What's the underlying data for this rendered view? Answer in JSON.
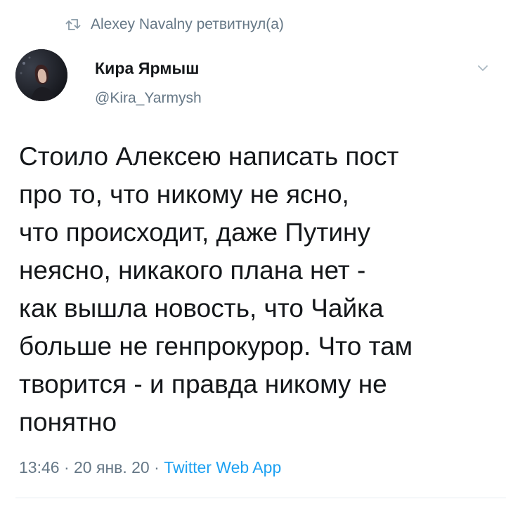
{
  "retweet_header": {
    "icon": "retweet-icon",
    "text": "Alexey Navalny ретвитнул(а)"
  },
  "author": {
    "avatar": "avatar-photo",
    "name": "Кира Ярмыш",
    "handle": "@Kira_Yarmysh"
  },
  "menu_icon": "chevron-down-icon",
  "tweet": {
    "lines": [
      "Стоило Алексею написать пост",
      "про то, что никому не ясно,",
      "что происходит, даже Путину",
      "неясно, никакого плана нет -",
      "как вышла новость, что Чайка",
      "больше не генпрокурор. Что там",
      "творится - и правда никому не",
      "понятно"
    ]
  },
  "meta": {
    "time": "13:46",
    "sep1": " · ",
    "date": "20 янв. 20",
    "sep2": " · ",
    "source": "Twitter Web App"
  },
  "colors": {
    "text": "#14171a",
    "secondary": "#657786",
    "link": "#1da1f2",
    "divider": "#e6ecf0"
  }
}
